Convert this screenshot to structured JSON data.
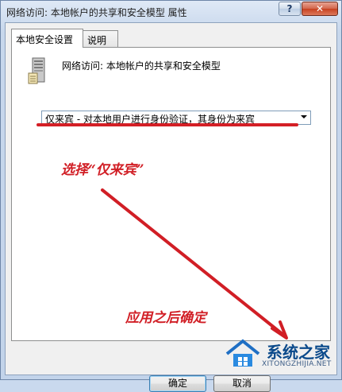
{
  "window": {
    "title": "网络访问: 本地帐户的共享和安全模型 属性",
    "help_label": "?",
    "close_label": "✕"
  },
  "tabs": [
    {
      "label": "本地安全设置",
      "active": true
    },
    {
      "label": "说明",
      "active": false
    }
  ],
  "policy": {
    "icon": "server-icon",
    "name": "网络访问: 本地帐户的共享和安全模型"
  },
  "dropdown": {
    "selected": "仅来宾 - 对本地用户进行身份验证，其身份为来宾"
  },
  "annotations": {
    "step1": "选择“仅来宾”",
    "step2": "应用之后确定",
    "color": "#d11e25"
  },
  "buttons": {
    "ok_label": "确定",
    "cancel_label": "取消"
  },
  "watermark": {
    "title": "系统之家",
    "url": "XITONGZHIJIA.NET"
  }
}
